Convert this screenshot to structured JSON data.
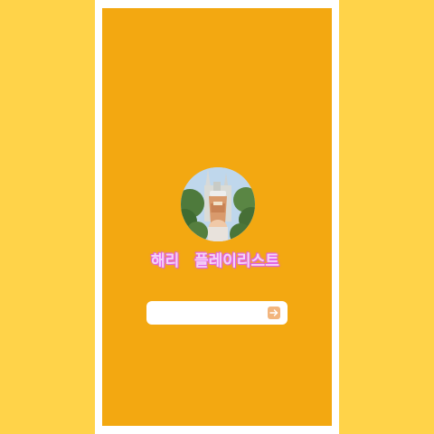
{
  "profile": {
    "avatar_icon": "profile-photo-icon"
  },
  "title": {
    "name": "해리",
    "label": "플레이리스트"
  },
  "entry": {
    "value": "",
    "placeholder": "",
    "submit_icon": "arrow-right-icon"
  },
  "colors": {
    "background": "#FFD349",
    "frame": "#FFFFFF",
    "screen": "#F3A811",
    "title_fill": "#F4D3F6",
    "title_glow": "#E86BEA",
    "button": "#F2B57E"
  }
}
